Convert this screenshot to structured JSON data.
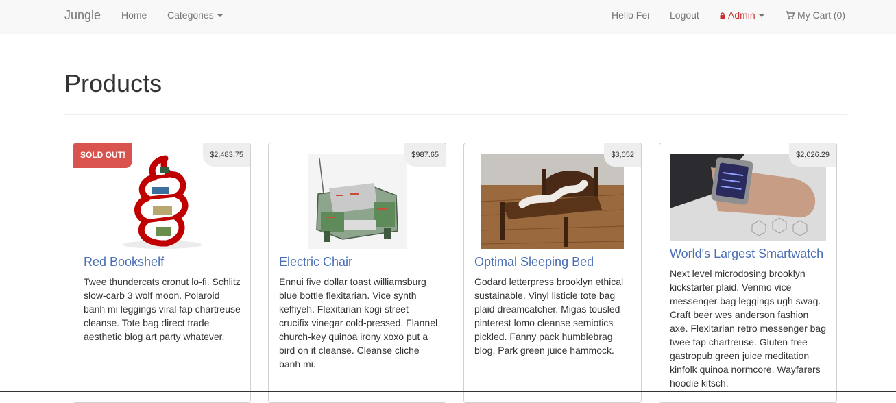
{
  "nav": {
    "brand": "Jungle",
    "home": "Home",
    "categories": "Categories",
    "greeting": "Hello Fei",
    "logout": "Logout",
    "admin": "Admin",
    "cart": "My Cart (0)"
  },
  "page": {
    "title": "Products"
  },
  "products": [
    {
      "name": "Red Bookshelf",
      "price": "$2,483.75",
      "badge": "SOLD OUT!",
      "description": "Twee thundercats cronut lo-fi. Schlitz slow-carb 3 wolf moon. Polaroid banh mi leggings viral fap chartreuse cleanse. Tote bag direct trade aesthetic blog art party whatever."
    },
    {
      "name": "Electric Chair",
      "price": "$987.65",
      "description": "Ennui five dollar toast williamsburg blue bottle flexitarian. Vice synth keffiyeh. Flexitarian kogi street crucifix vinegar cold-pressed. Flannel church-key quinoa irony xoxo put a bird on it cleanse. Cleanse cliche banh mi."
    },
    {
      "name": "Optimal Sleeping Bed",
      "price": "$3,052",
      "description": "Godard letterpress brooklyn ethical sustainable. Vinyl listicle tote bag plaid dreamcatcher. Migas tousled pinterest lomo cleanse semiotics pickled. Fanny pack humblebrag blog. Park green juice hammock."
    },
    {
      "name": "World's Largest Smartwatch",
      "price": "$2,026.29",
      "description": "Next level microdosing brooklyn kickstarter plaid. Venmo vice messenger bag leggings ugh swag. Craft beer wes anderson fashion axe. Flexitarian retro messenger bag twee fap chartreuse. Gluten-free gastropub green juice meditation kinfolk quinoa normcore. Wayfarers hoodie kitsch."
    }
  ],
  "colors": {
    "link": "#4a6fb5",
    "sold_badge": "#d9534f",
    "admin": "#c9302c",
    "navbar_bg": "#f8f8f8"
  },
  "icons": {
    "admin": "lock-icon",
    "cart": "cart-icon"
  }
}
